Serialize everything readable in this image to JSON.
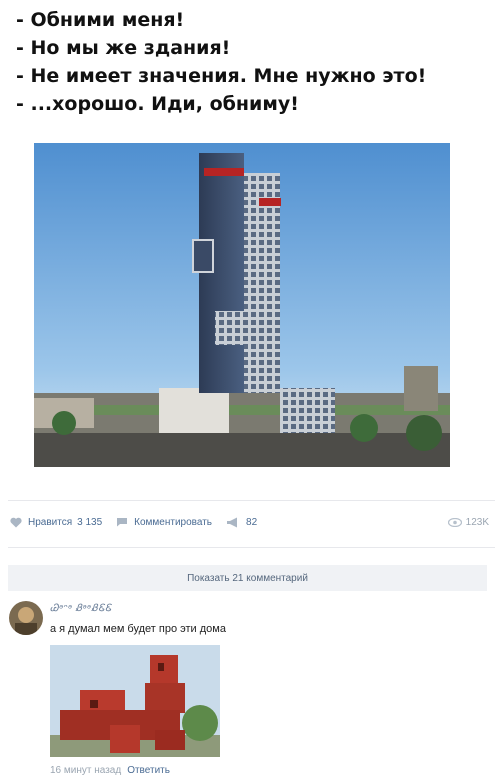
{
  "meme": {
    "lines": [
      "- Обними меня!",
      "- Но мы же здания!",
      "- Не имеет значения. Мне нужно это!",
      "- ...хорошо. Иди, обниму!"
    ]
  },
  "post_actions": {
    "like_label": "Нравится",
    "like_count": "3 135",
    "comment_label": "Комментировать",
    "share_count": "82",
    "views": "123K",
    "icons": {
      "like": "heart-icon",
      "comment": "comment-icon",
      "share": "megaphone-icon",
      "views": "eye-icon"
    }
  },
  "comments": {
    "show_more_label": "Показать 21 комментарий",
    "item": {
      "author": "Ꮚᵊᵔᵊ ᏰᵊᵊᏰᏋᏋ",
      "text": "а я думал мем будет про эти дома",
      "time": "16 минут назад",
      "reply_label": "Ответить"
    }
  },
  "colors": {
    "link": "#4a6b93",
    "muted": "#9aa5b1",
    "divider": "#e7e8ec",
    "button_bg": "#f0f2f5"
  }
}
